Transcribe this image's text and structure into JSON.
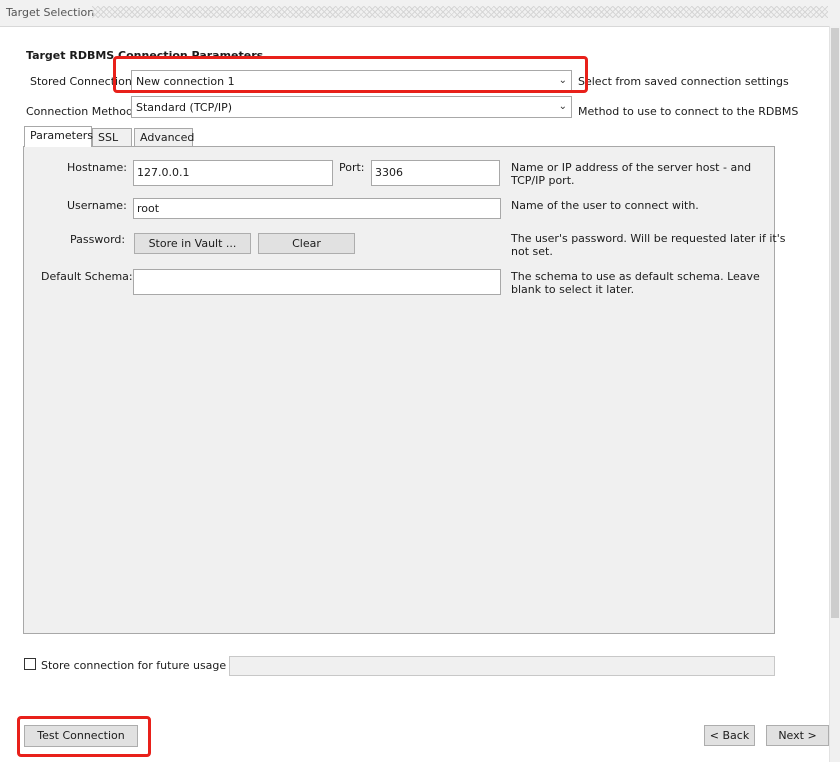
{
  "header": {
    "title": "Target Selection"
  },
  "section": {
    "title": "Target RDBMS Connection Parameters"
  },
  "stored_connection": {
    "label": "Stored Connection:",
    "value": "New connection 1",
    "hint": "Select from saved connection settings"
  },
  "connection_method": {
    "label": "Connection Method:",
    "value": "Standard (TCP/IP)",
    "hint": "Method to use to connect to the RDBMS"
  },
  "tabs": [
    {
      "label": "Parameters",
      "active": true
    },
    {
      "label": "SSL",
      "active": false
    },
    {
      "label": "Advanced",
      "active": false
    }
  ],
  "params": {
    "hostname_label": "Hostname:",
    "hostname_value": "127.0.0.1",
    "port_label": "Port:",
    "port_value": "3306",
    "hostname_hint_1": "Name or IP address of the server host - and",
    "hostname_hint_2": "TCP/IP port.",
    "username_label": "Username:",
    "username_value": "root",
    "username_hint": "Name of the user to connect with.",
    "password_label": "Password:",
    "store_vault_label": "Store in Vault ...",
    "clear_label": "Clear",
    "password_hint_1": "The user's password. Will be requested later if it's",
    "password_hint_2": "not set.",
    "schema_label": "Default Schema:",
    "schema_value": "",
    "schema_hint_1": "The schema to use as default schema. Leave",
    "schema_hint_2": "blank to select it later."
  },
  "store_future": {
    "label": "Store connection for future usage as",
    "checked": false,
    "value": ""
  },
  "footer": {
    "test_connection_label": "Test Connection",
    "back_label": "< Back",
    "next_label": "Next >"
  },
  "colors": {
    "highlight": "#e8201a",
    "panel": "#f0f0f0"
  }
}
